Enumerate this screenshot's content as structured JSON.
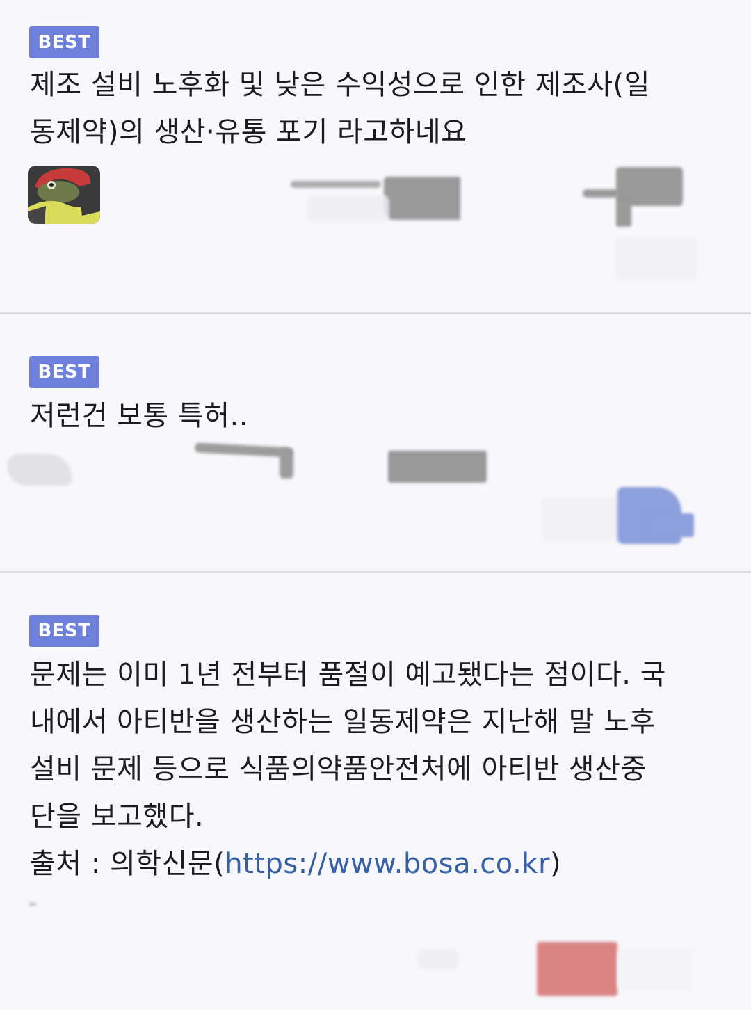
{
  "comments": [
    {
      "badge": "BEST",
      "text": "제조 설비 노후화 및 낮은 수익성으로 인한 제조사(일\n동제약)의 생산·유통 포기 라고하네요"
    },
    {
      "badge": "BEST",
      "text": "저런건 보통 특허.."
    },
    {
      "badge": "BEST",
      "text": "문제는 이미 1년 전부터 품절이 예고됐다는 점이다. 국\n내에서 아티반을 생산하는 일동제약은 지난해 말 노후\n설비 문제 등으로 식품의약품안전처에 아티반 생산중\n단을 보고했다.",
      "source_prefix": "출처 : 의학신문(",
      "source_link": "https://www.bosa.co.kr",
      "source_suffix": ")"
    }
  ],
  "colors": {
    "badge_bg": "#6f80db",
    "link": "#3560a8",
    "background": "#f8f8fc"
  }
}
